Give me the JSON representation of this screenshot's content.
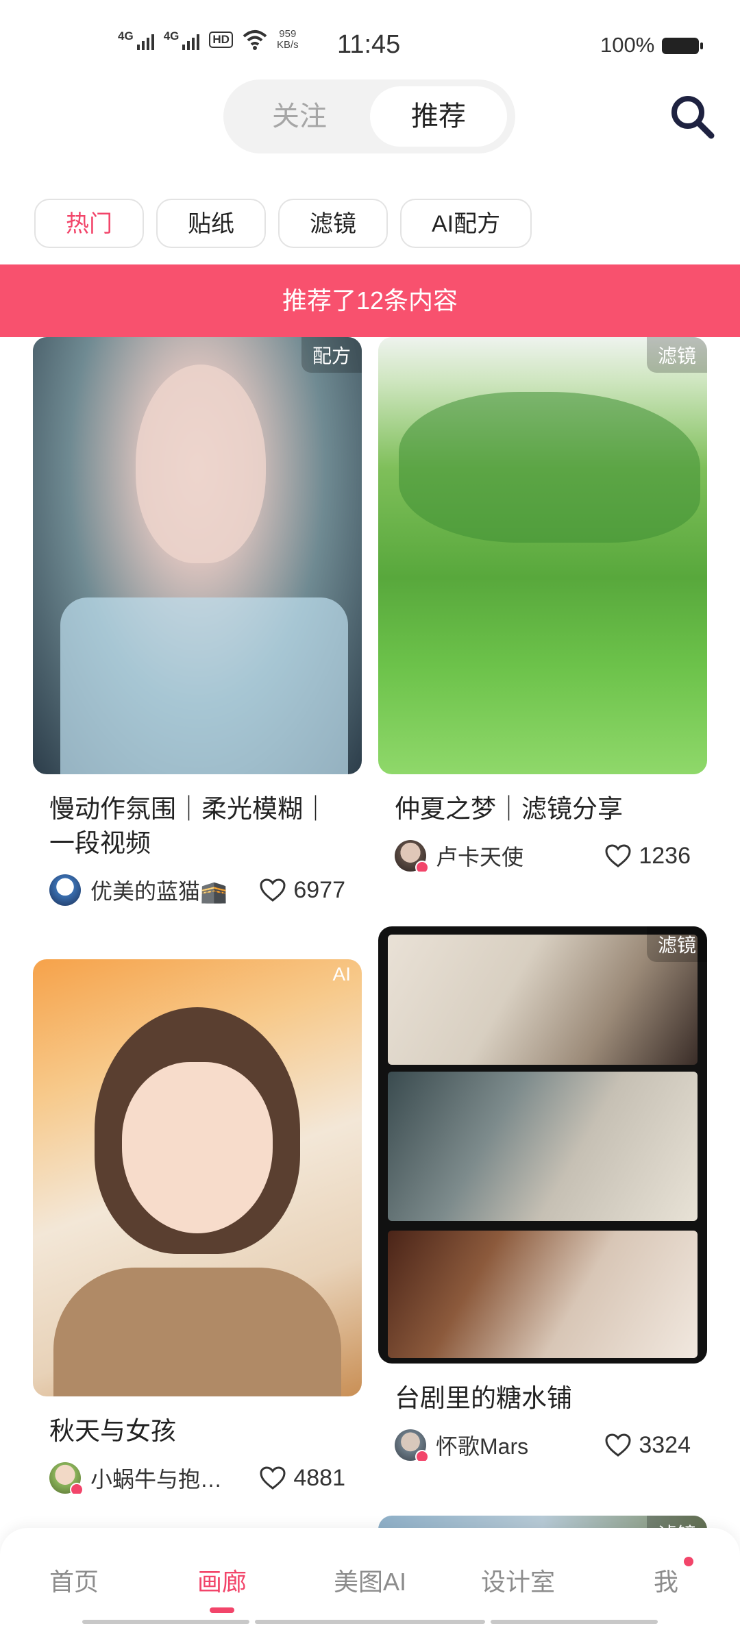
{
  "status_bar": {
    "net1": "4G",
    "net2": "4G",
    "hd": "HD",
    "speed_value": "959",
    "speed_unit": "KB/s",
    "time": "11:45",
    "battery": "100%"
  },
  "top_tabs": {
    "follow": "关注",
    "recommend": "推荐",
    "active": "推荐"
  },
  "chips": [
    "热门",
    "贴纸",
    "滤镜",
    "AI配方"
  ],
  "active_chip": "热门",
  "banner": "推荐了12条内容",
  "cards": [
    {
      "tag": "配方",
      "title": "慢动作氛围｜柔光模糊｜一段视频",
      "author": "优美的蓝猫🕋",
      "likes": "6977"
    },
    {
      "tag": "滤镜",
      "title": "仲夏之梦｜滤镜分享",
      "author": "卢卡天使",
      "likes": "1236"
    },
    {
      "tag": "AI",
      "title": "秋天与女孩",
      "author": "小蜗牛与抱…",
      "likes": "4881"
    },
    {
      "tag": "滤镜",
      "title": "台剧里的糖水铺",
      "author": "怀歌Mars",
      "likes": "3324"
    },
    {
      "tag": "滤镜"
    }
  ],
  "bottom_nav": [
    "首页",
    "画廊",
    "美图AI",
    "设计室",
    "我"
  ],
  "active_nav": "画廊",
  "colors": {
    "accent": "#f2456a",
    "banner": "#f8516e"
  }
}
